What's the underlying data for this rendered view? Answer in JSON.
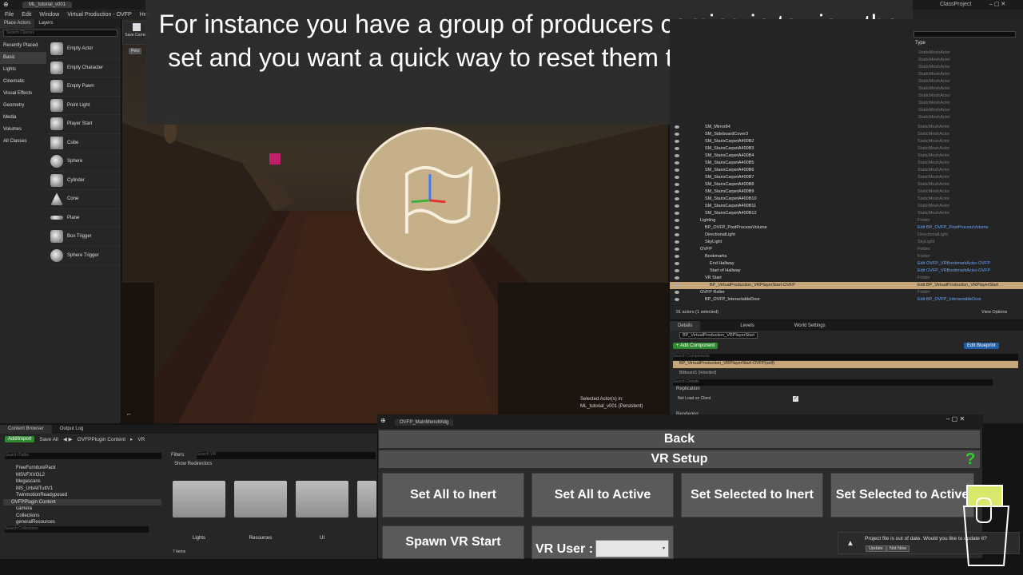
{
  "window": {
    "level_tab": "ML_tutorial_v001",
    "project": "ClassProject"
  },
  "menu": [
    "File",
    "Edit",
    "Window",
    "Virtual Production - OVFP",
    "Help"
  ],
  "modes": {
    "tabs": [
      "Place Actors",
      "Layers"
    ],
    "search_placeholder": "Search Classes",
    "categories": [
      "Recently Placed",
      "Basic",
      "Lights",
      "Cinematic",
      "Visual Effects",
      "Geometry",
      "Media",
      "Volumes",
      "All Classes"
    ],
    "items": [
      "Empty Actor",
      "Empty Character",
      "Empty Pawn",
      "Point Light",
      "Player Start",
      "Cube",
      "Sphere",
      "Cylinder",
      "Cone",
      "Plane",
      "Box Trigger",
      "Sphere Trigger"
    ]
  },
  "viewport": {
    "save_current": "Save Current",
    "perspective": "Pers",
    "selected_actor_line1": "Selected Actor(s) in:",
    "selected_actor_line2": "ML_tutorial_v001 (Persistent)"
  },
  "caption": "For instance you have a group of producers coming in to view the set and you want a quick way to reset them to the hero location.",
  "outliner": {
    "type_header": "Type",
    "type_column_top": [
      "StaticMeshActor",
      "StaticMeshActor",
      "StaticMeshActor",
      "StaticMeshActor",
      "StaticMeshActor",
      "StaticMeshActor",
      "StaticMeshActor",
      "StaticMeshActor",
      "StaticMeshActor",
      "StaticMeshActor"
    ],
    "rows": [
      {
        "name": "SM_Mirror84",
        "type": "StaticMeshActor",
        "indent": 34
      },
      {
        "name": "SM_SideboardCover3",
        "type": "StaticMeshActor",
        "indent": 34
      },
      {
        "name": "SM_StairsCarpetA400B2",
        "type": "StaticMeshActor",
        "indent": 34
      },
      {
        "name": "SM_StairsCarpetA400B3",
        "type": "StaticMeshActor",
        "indent": 34
      },
      {
        "name": "SM_StairsCarpetA400B4",
        "type": "StaticMeshActor",
        "indent": 34
      },
      {
        "name": "SM_StairsCarpetA400B5",
        "type": "StaticMeshActor",
        "indent": 34
      },
      {
        "name": "SM_StairsCarpetA400B6",
        "type": "StaticMeshActor",
        "indent": 34
      },
      {
        "name": "SM_StairsCarpetA400B7",
        "type": "StaticMeshActor",
        "indent": 34
      },
      {
        "name": "SM_StairsCarpetA400B8",
        "type": "StaticMeshActor",
        "indent": 34
      },
      {
        "name": "SM_StairsCarpetA400B9",
        "type": "StaticMeshActor",
        "indent": 34
      },
      {
        "name": "SM_StairsCarpetA400B10",
        "type": "StaticMeshActor",
        "indent": 34
      },
      {
        "name": "SM_StairsCarpetA400B11",
        "type": "StaticMeshActor",
        "indent": 34
      },
      {
        "name": "SM_StairsCarpetA400B12",
        "type": "StaticMeshActor",
        "indent": 34
      },
      {
        "name": "Lighting",
        "type": "Folder",
        "indent": 28
      },
      {
        "name": "BP_OVFP_PostProcessVolume",
        "type": "Edit BP_OVFP_PostProcessVolume",
        "indent": 34,
        "link": true
      },
      {
        "name": "DirectionalLight",
        "type": "DirectionalLight",
        "indent": 34
      },
      {
        "name": "SkyLight",
        "type": "SkyLight",
        "indent": 34
      },
      {
        "name": "OVFP",
        "type": "Folder",
        "indent": 28
      },
      {
        "name": "Bookmarks",
        "type": "Folder",
        "indent": 34
      },
      {
        "name": "End Hallway",
        "type": "Edit OVFP_VRBookmarkActor-OVFP",
        "indent": 40,
        "link": true
      },
      {
        "name": "Start of Hallway",
        "type": "Edit OVFP_VRBookmarkActor-OVFP",
        "indent": 40,
        "link": true
      },
      {
        "name": "VR Start",
        "type": "Folder",
        "indent": 34
      },
      {
        "name": "BP_VirtualProduction_VRPlayerStart-OVFP",
        "type": "Edit BP_VirtualProduction_VRPlayerStart",
        "indent": 40,
        "hl": true
      },
      {
        "name": "OVFP Roller",
        "type": "Folder",
        "indent": 28
      },
      {
        "name": "BP_OVFP_InteractableDoor",
        "type": "Edit BP_OVFP_InteractableDoor",
        "indent": 34,
        "link": true
      }
    ],
    "footer": "91 actors (1 selected)",
    "view_options": "View Options"
  },
  "details": {
    "tabs": [
      "Details",
      "Levels",
      "World Settings"
    ],
    "actor_name": "BP_VirtualProduction_VRPlayerStart",
    "add_component": "+ Add Component",
    "edit_blueprint": "Edit Blueprint",
    "search_components": "Search Components",
    "component_self": "BP_VirtualProduction_VRPlayerStart-OVFP(self)",
    "billboard": "Billboard1 (Inherited)",
    "search_details": "Search Details",
    "section": "Replication",
    "net_load_label": "Net Load on Client",
    "net_load_checked": true,
    "rendering": "Rendering"
  },
  "content_browser": {
    "tabs": [
      "Content Browser",
      "Output Log"
    ],
    "add_import": "Add/Import",
    "save_all": "Save All",
    "path": [
      "OVFPPlugin Content",
      "VR"
    ],
    "search_paths": "Search Paths",
    "filters": "Filters",
    "search_vr": "Search VR",
    "show_redirectors": "Show Redirectors",
    "tree": [
      "FreeFurniturePack",
      "MSVFXVOL2",
      "Megascans",
      "MS_UrbAllTuttV1",
      "TwinmotionReadyposed",
      "OVFPPlugin Content",
      "camera",
      "Collections",
      "generalResources"
    ],
    "folders": [
      "Lights",
      "Resources",
      "UI"
    ],
    "search_collections": "Search Collections",
    "items_count": "7 items"
  },
  "widget": {
    "title": "OVFP_MainMenuWidg",
    "back": "Back",
    "vr_setup": "VR Setup",
    "help": "?",
    "buttons": [
      "Set All to Inert",
      "Set All to Active",
      "Set Selected to Inert",
      "Set Selected to Active"
    ],
    "spawn": "Spawn VR Start",
    "vr_user_label": "VR User :"
  },
  "notification": {
    "message": "Project file is out of date. Would you like to update it?",
    "update": "Update",
    "not_now": "Not Now"
  }
}
